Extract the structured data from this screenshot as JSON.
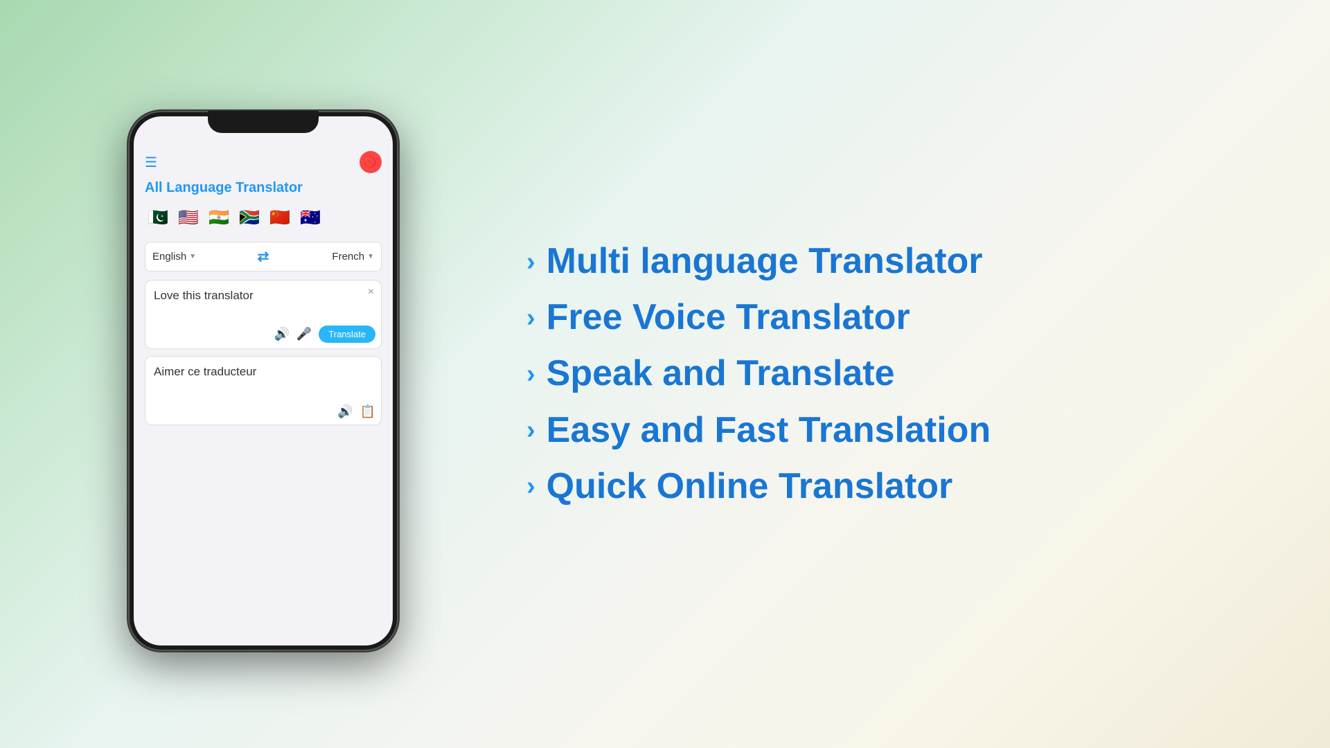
{
  "app": {
    "title": "All Language Translator",
    "menu_icon": "☰",
    "no_icon": "🚫",
    "flags": [
      "🇵🇰",
      "🇺🇸",
      "🇮🇳",
      "🇿🇦",
      "🇨🇳",
      "🇦🇺"
    ],
    "source_lang": "English",
    "target_lang": "French",
    "swap_icon": "⇄",
    "source_text": "Love this translator",
    "close_icon": "×",
    "speaker_icon": "🔊",
    "mic_icon": "🎤",
    "translate_btn": "Translate",
    "output_text": "Aimer ce traducteur",
    "copy_icon": "📋"
  },
  "features": [
    {
      "label": "Multi language Translator"
    },
    {
      "label": "Free Voice Translator"
    },
    {
      "label": "Speak and Translate"
    },
    {
      "label": "Easy and Fast Translation"
    },
    {
      "label": "Quick Online Translator"
    }
  ],
  "colors": {
    "accent": "#2196F3",
    "translate_btn": "#29b6f6",
    "feature_text": "#1565C0"
  }
}
